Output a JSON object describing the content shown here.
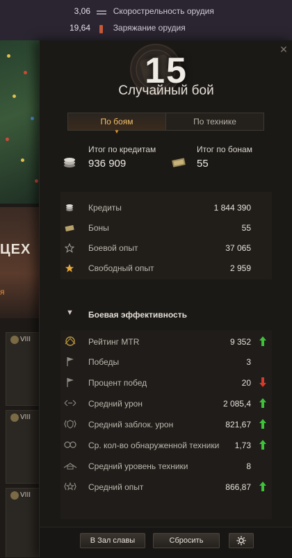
{
  "background_stats": [
    {
      "value": "3,06",
      "label": "Скорострельность орудия",
      "icon": "gun-rate-icon"
    },
    {
      "value": "19,64",
      "label": "Заряжание орудия",
      "icon": "reload-icon"
    }
  ],
  "background": {
    "banner_text": "ЦЕХ",
    "banner_sub": "я",
    "cards": [
      {
        "tier": "VIII"
      },
      {
        "tier": "VIII"
      },
      {
        "tier": "VIII"
      }
    ]
  },
  "panel": {
    "level": "15",
    "title": "Случайный бой",
    "tabs": [
      {
        "label": "По боям",
        "active": true
      },
      {
        "label": "По технике",
        "active": false
      }
    ],
    "totals": {
      "credits_label": "Итог по кредитам",
      "credits_value": "936 909",
      "bonds_label": "Итог по бонам",
      "bonds_value": "55"
    },
    "resources": [
      {
        "icon": "credits-icon",
        "label": "Кредиты",
        "value": "1 844 390"
      },
      {
        "icon": "bonds-icon",
        "label": "Боны",
        "value": "55"
      },
      {
        "icon": "star-outline-icon",
        "label": "Боевой опыт",
        "value": "37 065"
      },
      {
        "icon": "star-gold-icon",
        "label": "Свободный опыт",
        "value": "2 959"
      }
    ],
    "efficiency_header": "Боевая эффективность",
    "efficiency": [
      {
        "icon": "mtr-rating-icon",
        "label": "Рейтинг MTR",
        "value": "9 352",
        "trend": "up"
      },
      {
        "icon": "victory-flag-icon",
        "label": "Победы",
        "value": "3",
        "trend": ""
      },
      {
        "icon": "win-rate-flag-icon",
        "label": "Процент побед",
        "value": "20",
        "trend": "down"
      },
      {
        "icon": "damage-icon",
        "label": "Средний урон",
        "value": "2 085,4",
        "trend": "up"
      },
      {
        "icon": "blocked-damage-icon",
        "label": "Средний заблок. урон",
        "value": "821,67",
        "trend": "up"
      },
      {
        "icon": "spotted-icon",
        "label": "Ср. кол-во обнаруженной техники",
        "value": "1,73",
        "trend": "up"
      },
      {
        "icon": "tier-icon",
        "label": "Средний уровень техники",
        "value": "8",
        "trend": ""
      },
      {
        "icon": "avg-exp-icon",
        "label": "Средний опыт",
        "value": "866,87",
        "trend": "up"
      }
    ],
    "buttons": {
      "hall_of_fame": "В Зал славы",
      "reset": "Сбросить",
      "settings_icon": "gear-icon"
    }
  },
  "colors": {
    "accent": "#f2c06a",
    "trend_up": "#3ec23a",
    "trend_down": "#d63a2a"
  }
}
